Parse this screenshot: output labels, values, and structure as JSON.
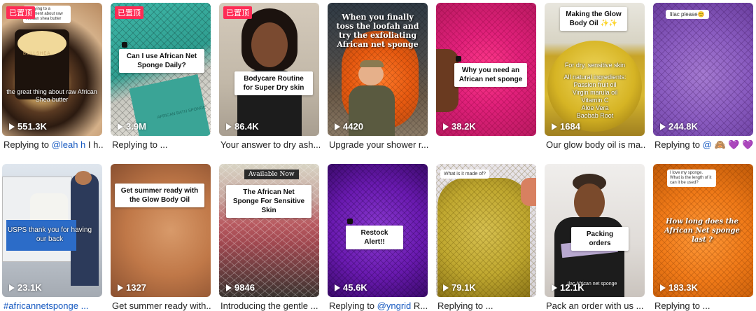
{
  "tag_pinned": "已置顶",
  "colors": {
    "mention": "#1558c0",
    "pinned": "#fe2c55"
  },
  "row1": [
    {
      "views": "551.3K",
      "pinned": true,
      "caption_prefix": "Replying to ",
      "caption_mention": "@leah h",
      "caption_suffix": " I h...",
      "overlay": "the great thing about raw African Shea butter",
      "bubble": "Replying to a comment about raw African shea butter"
    },
    {
      "views": "3.9M",
      "pinned": true,
      "caption_prefix": "Replying to ...",
      "sticker": "Can I use African Net Sponge Daily?",
      "sponge_label": "AFRICAN BATH SPONGE"
    },
    {
      "views": "86.4K",
      "pinned": true,
      "caption_prefix": "Your answer to dry ash...",
      "sticker": "Bodycare Routine for Super Dry skin"
    },
    {
      "views": "4420",
      "caption_prefix": "Upgrade your shower r...",
      "title": "When you finally toss the loofah and try the exfoliating African net sponge"
    },
    {
      "views": "38.2K",
      "caption_prefix": "",
      "sticker": "Why you need an African net sponge"
    },
    {
      "views": "1684",
      "caption_prefix": "Our glow body oil is ma...",
      "sticker": "Making the Glow Body Oil ✨✨",
      "ingredients": [
        "For dry, sensitive skin",
        "All natural ingredients:",
        "Passion fruit oil",
        "Virgin marula oil",
        "Vitamin C",
        "Aloe Vera",
        "Baobab Root"
      ]
    },
    {
      "views": "244.8K",
      "caption_prefix": "Replying to ",
      "caption_mention": "@ 🙈 💜 💜",
      "bubble": "lilac please😊"
    }
  ],
  "row2": [
    {
      "views": "23.1K",
      "caption_prefix": "",
      "caption_mention": "#africannetsponge ...",
      "overlay": "USPS thank you for having our back"
    },
    {
      "views": "1327",
      "caption_prefix": "Get summer ready with...",
      "sticker": "Get summer ready with the Glow Body Oil"
    },
    {
      "views": "9846",
      "caption_prefix": "Introducing the gentle ...",
      "banner": "Available Now",
      "sticker": "The African Net Sponge For Sensitive Skin"
    },
    {
      "views": "45.6K",
      "caption_prefix": "Replying to ",
      "caption_mention": "@yngrid",
      "caption_suffix": " R...",
      "sticker": "Restock Alert!!"
    },
    {
      "views": "79.1K",
      "caption_prefix": "Replying to ...",
      "bubble": "What is it made of?"
    },
    {
      "views": "12.1K",
      "caption_prefix": "Pack an order with us ...",
      "sticker": "Packing orders",
      "footer": "Ilac African net sponge"
    },
    {
      "views": "183.3K",
      "caption_prefix": "Replying to ...",
      "bubble": "I love my sponge. What is the length of it can it be used?",
      "title": "How long does the African Net sponge last ?"
    }
  ]
}
